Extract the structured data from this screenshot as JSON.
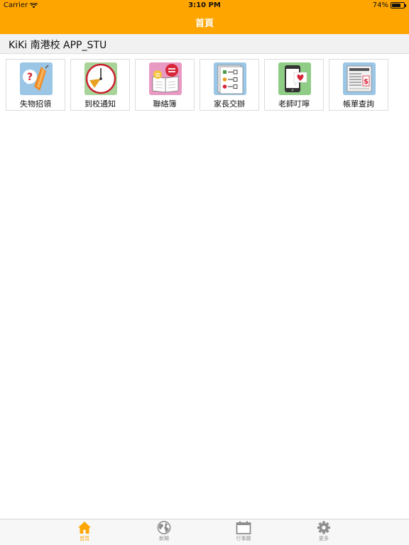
{
  "status": {
    "carrier": "Carrier",
    "time": "3:10 PM",
    "battery": "74%",
    "battery_level": 0.74
  },
  "header": {
    "title": "首頁"
  },
  "school": {
    "name": "KiKi 南港校 APP_STU"
  },
  "tiles": [
    {
      "label": "失物招領",
      "icon": "lost-and-found-icon"
    },
    {
      "label": "到校通知",
      "icon": "clock-icon"
    },
    {
      "label": "聯絡簿",
      "icon": "contact-book-icon"
    },
    {
      "label": "家長交辦",
      "icon": "checklist-icon"
    },
    {
      "label": "老師叮嚀",
      "icon": "phone-heart-icon"
    },
    {
      "label": "帳單查詢",
      "icon": "bill-icon"
    }
  ],
  "tabs": [
    {
      "label": "首頁",
      "icon": "home-icon",
      "active": true
    },
    {
      "label": "新聞",
      "icon": "globe-icon",
      "active": false
    },
    {
      "label": "行事曆",
      "icon": "calendar-icon",
      "active": false
    },
    {
      "label": "更多",
      "icon": "gear-icon",
      "active": false
    }
  ],
  "colors": {
    "accent": "#fea500",
    "tab_inactive": "#8e8e8e",
    "school_bar": "#f1f1f1"
  }
}
